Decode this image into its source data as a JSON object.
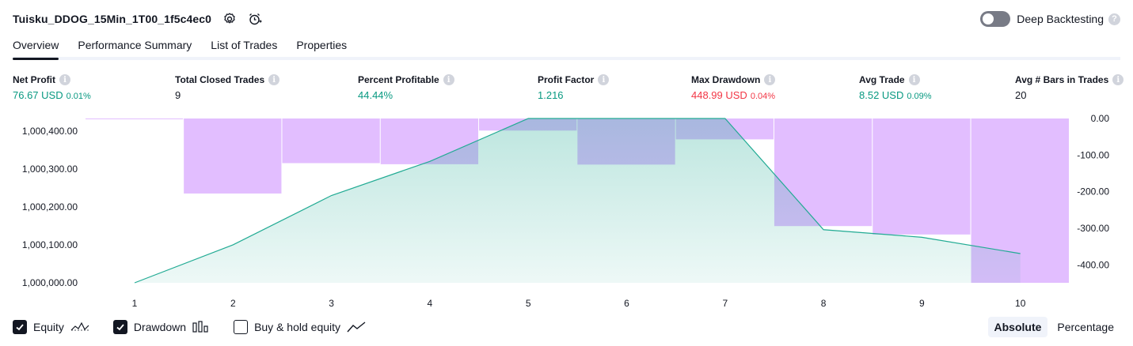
{
  "header": {
    "title": "Tuisku_DDOG_15Min_1T00_1f5c4ec0",
    "deep_label": "Deep Backtesting",
    "deep_help": "?"
  },
  "tabs": [
    {
      "label": "Overview"
    },
    {
      "label": "Performance Summary"
    },
    {
      "label": "List of Trades"
    },
    {
      "label": "Properties"
    }
  ],
  "metrics": [
    {
      "label": "Net Profit",
      "value": "76.67 USD",
      "pct": "0.01%",
      "color": "#089981"
    },
    {
      "label": "Total Closed Trades",
      "value": "9",
      "pct": "",
      "color": "#131722"
    },
    {
      "label": "Percent Profitable",
      "value": "44.44%",
      "pct": "",
      "color": "#089981"
    },
    {
      "label": "Profit Factor",
      "value": "1.216",
      "pct": "",
      "color": "#089981"
    },
    {
      "label": "Max Drawdown",
      "value": "448.99 USD",
      "pct": "0.04%",
      "color": "#f23645"
    },
    {
      "label": "Avg Trade",
      "value": "8.52 USD",
      "pct": "0.09%",
      "color": "#089981"
    },
    {
      "label": "Avg # Bars in Trades",
      "value": "20",
      "pct": "",
      "color": "#131722"
    }
  ],
  "info_glyph": "i",
  "chart_data": {
    "type": "area",
    "x": [
      1,
      2,
      3,
      4,
      5,
      6,
      7,
      8,
      9,
      10
    ],
    "x_tick_labels": [
      "1",
      "2",
      "3",
      "4",
      "5",
      "6",
      "7",
      "8",
      "9",
      "10"
    ],
    "left_axis": {
      "ticks": [
        "1,000,400.00",
        "1,000,300.00",
        "1,000,200.00",
        "1,000,100.00",
        "1,000,000.00"
      ],
      "tick_values": [
        1000400,
        1000300,
        1000200,
        1000100,
        1000000
      ],
      "ylim": [
        1000000,
        1000433
      ]
    },
    "right_axis": {
      "ticks": [
        "0.00",
        "-100.00",
        "-200.00",
        "-300.00",
        "-400.00"
      ],
      "tick_values": [
        0,
        -100,
        -200,
        -300,
        -400
      ],
      "ylim": [
        -449,
        0
      ]
    },
    "series": [
      {
        "name": "Equity",
        "type": "area",
        "axis": "left",
        "color": "#22ab94",
        "values": [
          1000000,
          1000100,
          1000230,
          1000320,
          1000433,
          1000433,
          1000433,
          1000140,
          1000120,
          1000077
        ]
      },
      {
        "name": "Drawdown",
        "type": "bar",
        "axis": "right",
        "color": "#ce93ff",
        "values": [
          -1,
          -205,
          -122,
          -125,
          -33,
          -126,
          -57,
          -294,
          -317,
          -449
        ]
      }
    ]
  },
  "legend": [
    {
      "label": "Equity",
      "checked": true
    },
    {
      "label": "Drawdown",
      "checked": true
    },
    {
      "label": "Buy & hold equity",
      "checked": false
    }
  ],
  "modes": [
    {
      "label": "Absolute",
      "active": true
    },
    {
      "label": "Percentage",
      "active": false
    }
  ]
}
